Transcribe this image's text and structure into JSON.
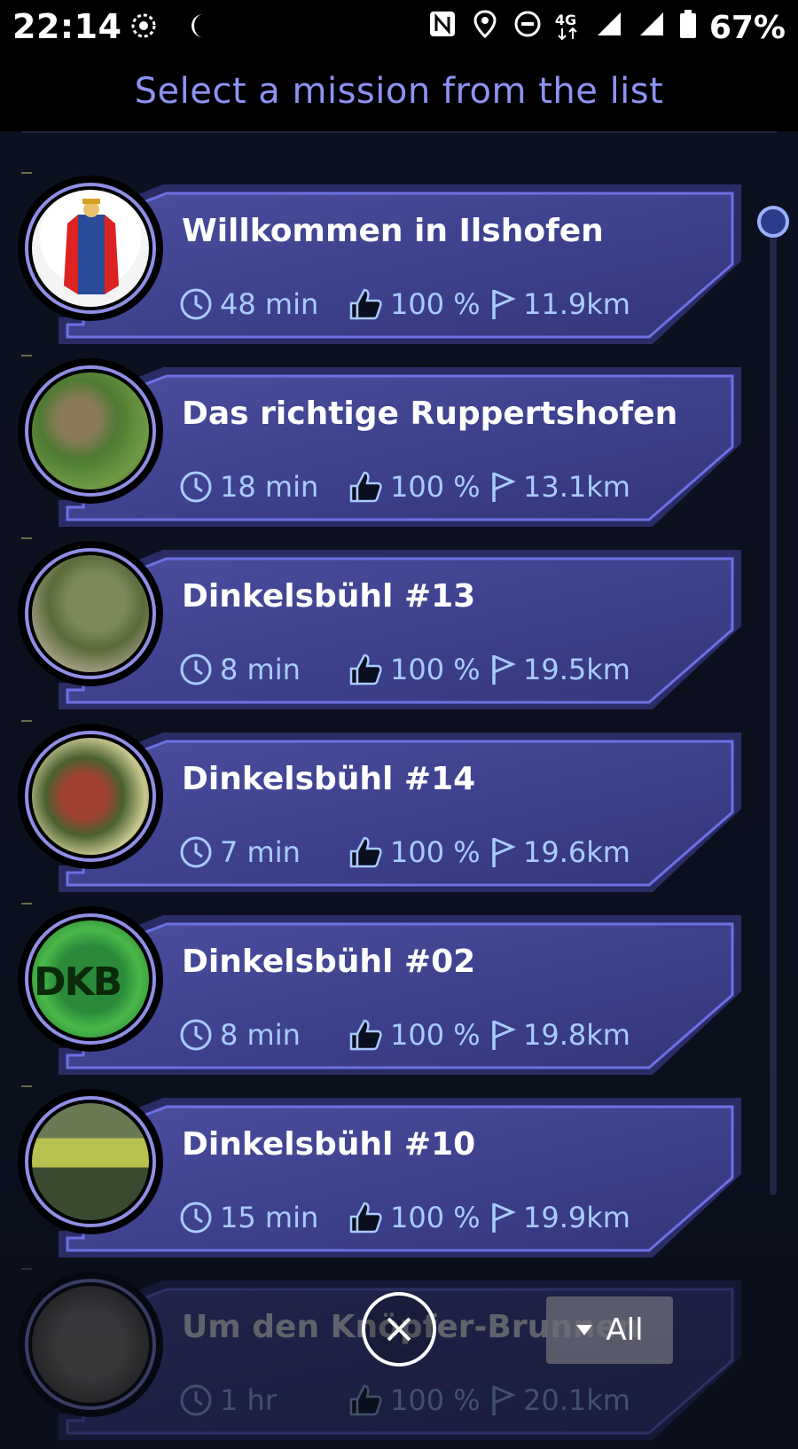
{
  "status_bar": {
    "time": "22:14",
    "left_icons": [
      "hotspot-icon",
      "moon-icon"
    ],
    "right_icons": [
      "nfc-icon",
      "location-icon",
      "dnd-icon",
      "4g-icon",
      "signal-1-icon",
      "signal-2-icon",
      "battery-icon"
    ],
    "network": "4G",
    "battery": "67%"
  },
  "header": {
    "title": "Select a mission from the list"
  },
  "missions": [
    {
      "title": "Willkommen in Ilshofen",
      "time": "48 min",
      "rating": "100 %",
      "distance": "11.9km"
    },
    {
      "title": "Das richtige Ruppertshofen",
      "time": "18 min",
      "rating": "100 %",
      "distance": "13.1km"
    },
    {
      "title": "Dinkelsbühl #13",
      "time": "8 min",
      "rating": "100 %",
      "distance": "19.5km"
    },
    {
      "title": "Dinkelsbühl #14",
      "time": "7 min",
      "rating": "100 %",
      "distance": "19.6km"
    },
    {
      "title": "Dinkelsbühl #02",
      "time": "8 min",
      "rating": "100 %",
      "distance": "19.8km"
    },
    {
      "title": "Dinkelsbühl #10",
      "time": "15 min",
      "rating": "100 %",
      "distance": "19.9km"
    },
    {
      "title": "Um den Knöpfer-Brunnen",
      "time": "1 hr",
      "rating": "100 %",
      "distance": "20.1km"
    }
  ],
  "thumbnail_text": {
    "dkb": "DKB"
  },
  "filter": {
    "label": "All"
  },
  "colors": {
    "accent": "#8e92f2",
    "card": "#3d3f8c",
    "card_border": "#6a6de0",
    "stat_text": "#a8ccff"
  }
}
